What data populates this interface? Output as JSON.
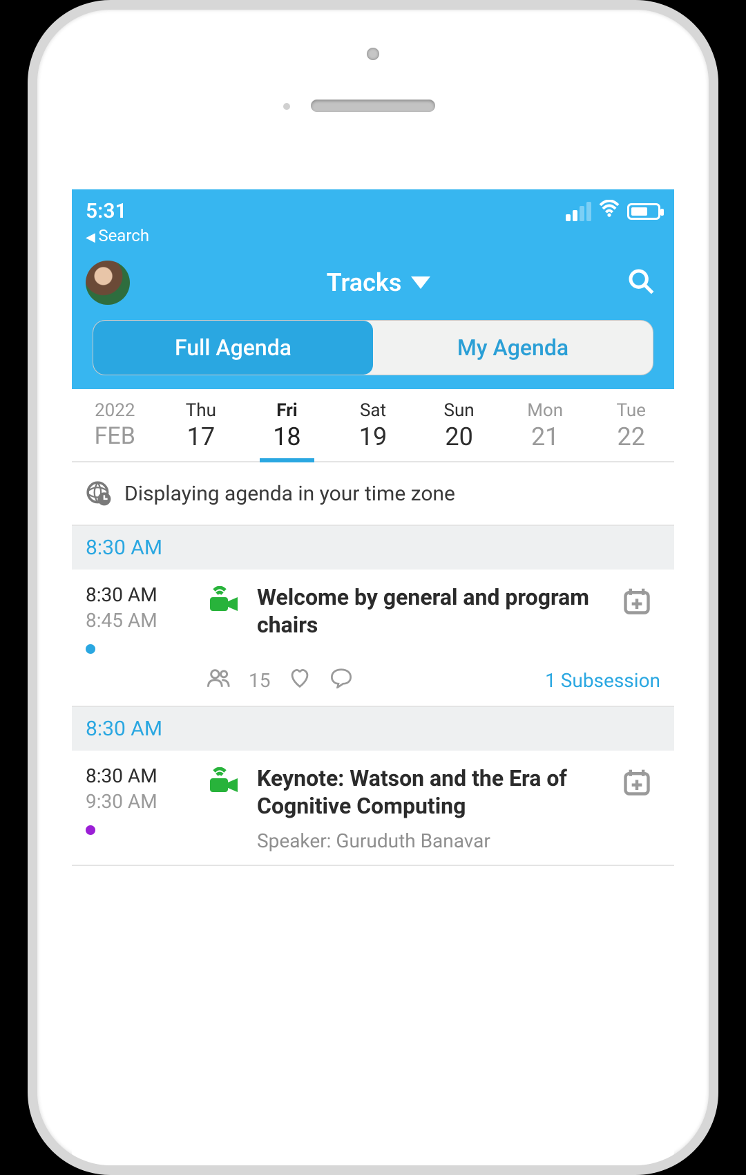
{
  "status": {
    "time": "5:31",
    "back_label": "Search"
  },
  "header": {
    "title": "Tracks",
    "tabs": {
      "full": "Full Agenda",
      "mine": "My Agenda",
      "active": "full"
    }
  },
  "date_strip": {
    "year": "2022",
    "month": "FEB",
    "days": [
      {
        "label": "Thu",
        "num": "17"
      },
      {
        "label": "Fri",
        "num": "18",
        "selected": true
      },
      {
        "label": "Sat",
        "num": "19"
      },
      {
        "label": "Sun",
        "num": "20"
      },
      {
        "label": "Mon",
        "num": "21",
        "muted": true
      },
      {
        "label": "Tue",
        "num": "22",
        "muted": true
      }
    ]
  },
  "tz_notice": "Displaying agenda in your time zone",
  "sections": [
    {
      "time_header": "8:30 AM",
      "session": {
        "start": "8:30 AM",
        "end": "8:45 AM",
        "dot_color": "blue",
        "title": "Welcome by general and program chairs",
        "attendees": "15",
        "subsession_label": "1 Subsession"
      }
    },
    {
      "time_header": "8:30 AM",
      "session": {
        "start": "8:30 AM",
        "end": "9:30 AM",
        "dot_color": "purple",
        "title": "Keynote: Watson and the Era of Cognitive Computing",
        "speaker": "Speaker: Guruduth Banavar"
      }
    }
  ],
  "colors": {
    "accent": "#37b6f0",
    "link": "#2aa7e1"
  }
}
